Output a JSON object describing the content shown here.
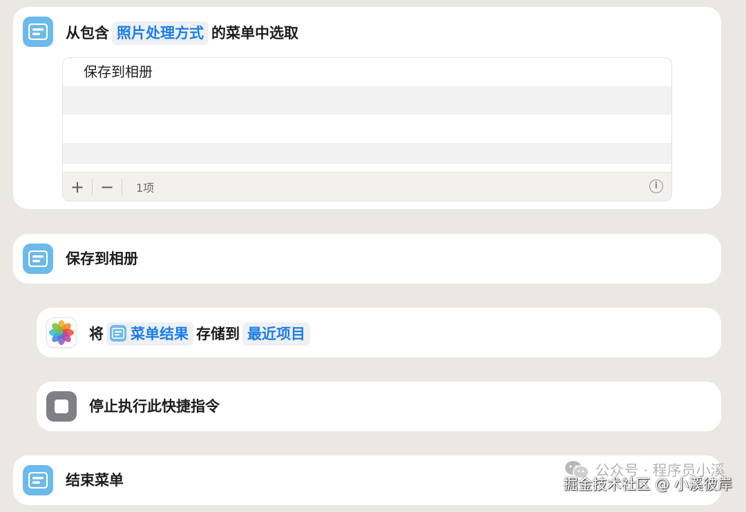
{
  "actions": {
    "choose_menu": {
      "prefix": "从包含",
      "token": "照片处理方式",
      "suffix": "的菜单中选取",
      "icon": "menu-list-icon",
      "list_items": [
        "保存到相册"
      ],
      "toolbar": {
        "add": "+",
        "remove": "−",
        "count": "1项",
        "info": "i"
      }
    },
    "menu_case": {
      "label": "保存到相册",
      "icon": "menu-list-icon"
    },
    "save_photo": {
      "prefix": "将",
      "token_input": "菜单结果",
      "middle": "存储到",
      "token_album": "最近项目",
      "icon": "photos-app-icon"
    },
    "stop": {
      "label": "停止执行此快捷指令",
      "icon": "stop-icon"
    },
    "end_menu": {
      "label": "结束菜单",
      "icon": "menu-list-icon"
    }
  },
  "watermark": {
    "line1": "公众号 · 程序员小溪",
    "line2": "掘金技术社区 @ 小溪彼岸"
  },
  "colors": {
    "background": "#ebe8e4",
    "card": "#ffffff",
    "accent_blue": "#1a7ee6",
    "menu_icon": "#6cb9ea",
    "stop_icon": "#7f7f84"
  }
}
